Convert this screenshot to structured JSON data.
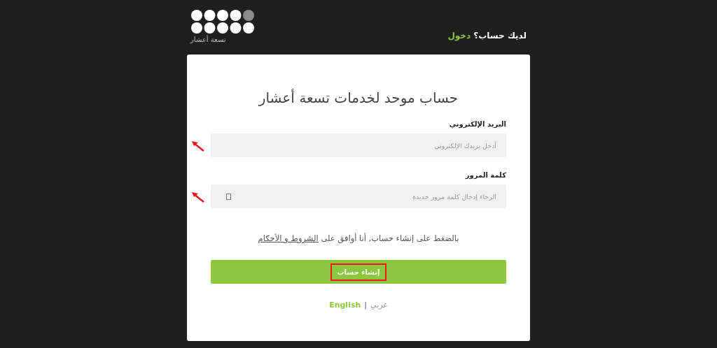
{
  "logo": {
    "caption": "تسعة أعشار"
  },
  "header": {
    "prompt": "لديك حساب؟",
    "login_link": "دخول"
  },
  "form": {
    "title": "حساب موحد لخدمات تسعة أعشار",
    "fields": [
      {
        "label": "البريد الإلكتروني",
        "placeholder": "أدخل بريدك الإلكتروني",
        "kind": "email",
        "annotated": true
      },
      {
        "label": "كلمة المرور",
        "placeholder": "الرجاء إدخال كلمة مرور جديدة",
        "kind": "password",
        "annotated": true
      }
    ],
    "terms_text": "بالضغط على إنشاء حساب, أنا أوافق على",
    "terms_link": "الشروط و الأحكام",
    "submit": {
      "label": "إنشاء حساب",
      "annotated": true
    }
  },
  "languages": [
    {
      "label": "عربي",
      "selected": false
    },
    {
      "label": "English",
      "selected": true
    }
  ],
  "language_separator": "|"
}
